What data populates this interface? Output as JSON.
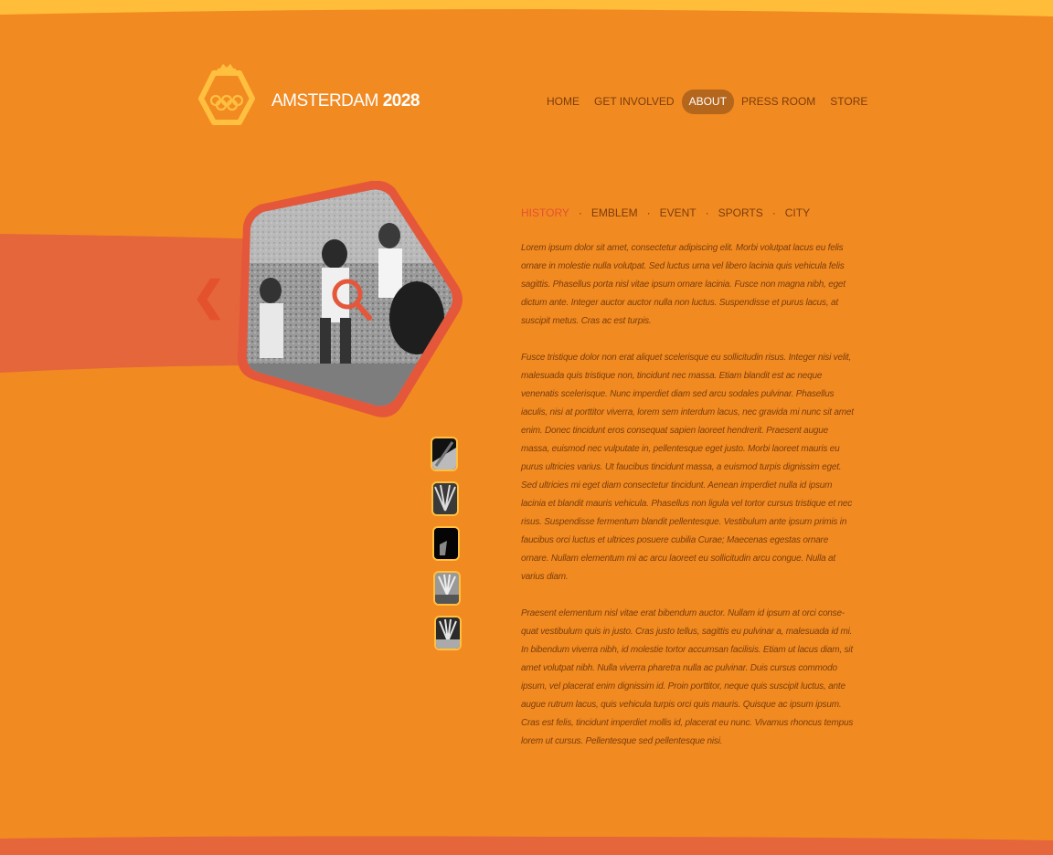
{
  "brand": {
    "name_regular": "AMSTERDAM",
    "name_bold": "2028",
    "logo_icon": "olympic-crown-emblem"
  },
  "nav": {
    "items": [
      {
        "label": "HOME",
        "active": false
      },
      {
        "label": "GET INVOLVED",
        "active": false
      },
      {
        "label": "ABOUT",
        "active": true
      },
      {
        "label": "PRESS ROOM",
        "active": false
      },
      {
        "label": "STORE",
        "active": false
      }
    ]
  },
  "gallery": {
    "prev_icon": "chevron-left-icon",
    "zoom_icon": "magnifier-icon",
    "thumb_count": 5
  },
  "subnav": {
    "tabs": [
      {
        "label": "HISTORY",
        "active": true
      },
      {
        "label": "EMBLEM",
        "active": false
      },
      {
        "label": "EVENT",
        "active": false
      },
      {
        "label": "SPORTS",
        "active": false
      },
      {
        "label": "CITY",
        "active": false
      }
    ],
    "separator": "·"
  },
  "content": {
    "paragraphs": [
      "Lorem ipsum dolor sit amet, consectetur adipiscing elit. Morbi volutpat lacus eu felis ornare in molestie nulla volutpat. Sed luctus urna vel libero lacinia quis vehicula felis sagittis. Phasellus porta nisl vitae ipsum ornare lacinia. Fusce non magna nibh, eget dictum ante. Integer auctor auctor nulla non luctus. Suspendisse et purus lacus, at suscipit metus. Cras ac est turpis.",
      "Fusce tristique dolor non erat aliquet scelerisque eu sollicitudin risus. Integer nisi velit, malesuada quis tristique non, tincidunt nec massa. Etiam blandit est ac neque venenatis scelerisque. Nunc imperdiet diam sed arcu sodales pulvinar. Phasellus iaculis, nisi at porttitor viverra, lorem sem interdum lacus, nec gravida mi nunc sit amet enim. Donec tincidunt eros consequat sapien laoreet hendrerit. Praesent augue massa, euismod nec vulputate in, pellentesque eget justo. Morbi laoreet mauris eu purus ultricies varius. Ut faucibus tincidunt massa, a euismod turpis dignissim eget. Sed ultricies mi eget diam consectetur tincidunt. Aenean imperdiet nulla id ipsum lacinia et blandit mauris vehicula. Phasellus non ligula vel tortor cursus tristique et nec risus. Suspendisse fermentum blandit pellentesque. Vestibulum ante ipsum primis in faucibus orci luctus et ultrices posuere cubilia Curae; Maecenas egestas ornare ornare. Nullam elementum mi ac arcu laoreet eu sollicitudin arcu congue. Nulla at varius diam.",
      "Praesent elementum nisl vitae erat bibendum auctor. Nullam id ipsum at orci conse-quat vestibulum quis in justo. Cras justo tellus, sagittis eu pulvinar a, malesuada id mi. In bibendum viverra nibh, id molestie tortor accumsan facilisis. Etiam ut lacus diam, sit amet volutpat nibh. Nulla viverra pharetra nulla ac pulvinar. Duis cursus commodo ipsum, vel placerat enim dignissim id. Proin porttitor, neque quis suscipit luctus, ante augue rutrum lacus, quis vehicula turpis orci quis mauris. Quisque ac ipsum ipsum. Cras est felis, tincidunt imperdiet mollis id, placerat eu nunc. Vivamus rhoncus tempus lorem ut cursus. Pellentesque sed pellentesque nisi."
    ]
  },
  "colors": {
    "background": "#f28a22",
    "top_band": "#ffbd3a",
    "accent_red": "#e4512d",
    "nav_active": "#b4661d",
    "text": "#7a3e0a",
    "logo": "#ffc040"
  }
}
